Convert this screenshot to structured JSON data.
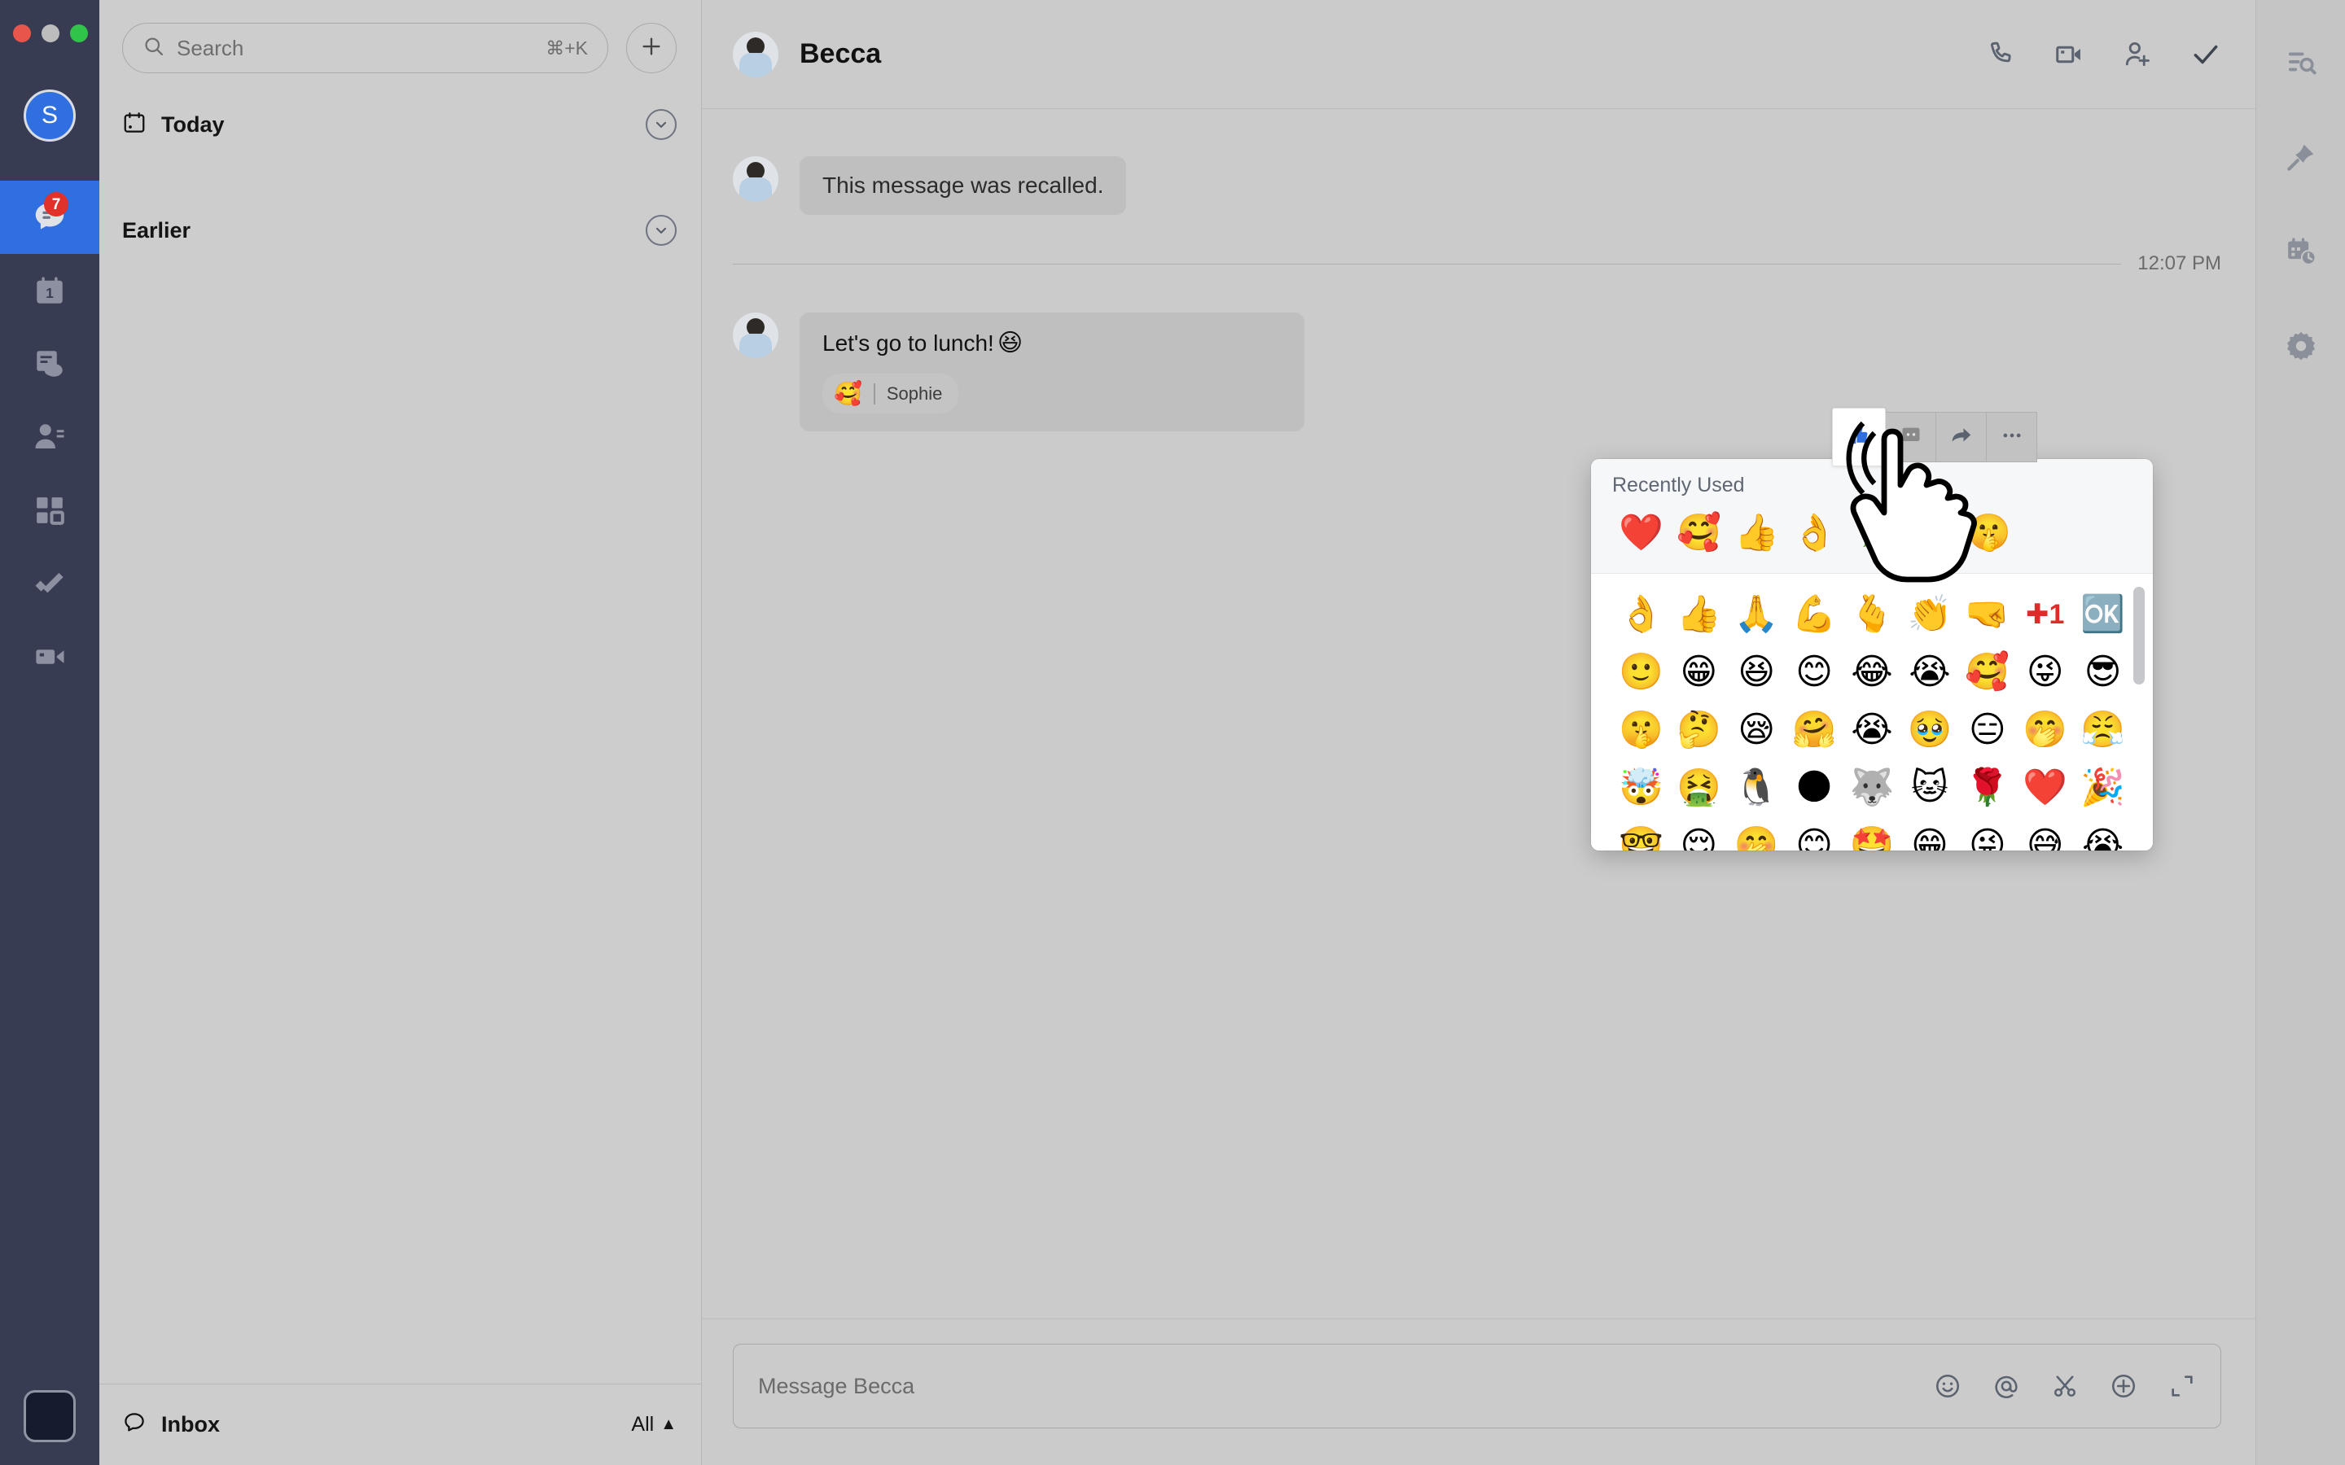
{
  "window": {
    "traffic_lights": [
      "close",
      "minimize",
      "zoom"
    ]
  },
  "rail": {
    "avatar_initial": "S",
    "items": [
      {
        "name": "chat",
        "icon": "chat-icon",
        "active": true,
        "badge": "7"
      },
      {
        "name": "calendar",
        "icon": "calendar-icon",
        "badge": ""
      },
      {
        "name": "docs",
        "icon": "docs-cloud-icon",
        "badge": ""
      },
      {
        "name": "contacts",
        "icon": "contacts-icon",
        "badge": ""
      },
      {
        "name": "workspace",
        "icon": "grid-apps-icon",
        "badge": ""
      },
      {
        "name": "tasks",
        "icon": "check-pen-icon",
        "badge": ""
      },
      {
        "name": "meetings",
        "icon": "video-camera-icon",
        "badge": ""
      }
    ]
  },
  "sidebar": {
    "search": {
      "placeholder": "Search",
      "shortcut": "⌘+K"
    },
    "new_button": "new-chat-button",
    "sections": [
      {
        "label": "Today",
        "icon": "calendar-today-icon",
        "collapse": "chevron-down-icon"
      },
      {
        "label": "Earlier",
        "icon": "",
        "collapse": "chevron-down-icon"
      }
    ],
    "footer": {
      "label": "Inbox",
      "icon": "inbox-icon",
      "filter": "All",
      "filter_caret": "▲"
    }
  },
  "header": {
    "title": "Becca",
    "actions": [
      {
        "name": "call-button",
        "icon": "phone-icon"
      },
      {
        "name": "video-call-button",
        "icon": "video-icon"
      },
      {
        "name": "add-member-button",
        "icon": "add-person-icon"
      },
      {
        "name": "mark-done-button",
        "icon": "check-icon"
      }
    ]
  },
  "thread": {
    "messages": [
      {
        "sender": "Becca",
        "text": "This message was recalled.",
        "recalled": true
      },
      {
        "sender": "Becca",
        "text": "Let's go to lunch!",
        "trailing_emoji": "😆",
        "reaction": {
          "emoji": "🥰",
          "by": "Sophie"
        }
      }
    ],
    "divider_time": "12:07 PM"
  },
  "hover_toolbar": {
    "buttons": [
      {
        "name": "thumbs-up-reaction-button",
        "icon": "thumbs-up-icon",
        "active": true
      },
      {
        "name": "emoji-reaction-button",
        "icon": "emoji-icon",
        "active": false
      },
      {
        "name": "forward-button",
        "icon": "forward-arrow-icon",
        "active": false
      },
      {
        "name": "more-actions-button",
        "icon": "ellipsis-icon",
        "active": false
      }
    ]
  },
  "emoji_picker": {
    "recent_title": "Recently Used",
    "recent": [
      "❤️",
      "🥰",
      "👍",
      "👌",
      "🌹",
      "🤫"
    ],
    "grid_rows": [
      [
        "👌",
        "👍",
        "🙏",
        "💪",
        "🫰",
        "👏",
        "🤜",
        "✚️1",
        "🆗"
      ],
      [
        "🙂",
        "😁",
        "😆",
        "😊",
        "😂",
        "😭",
        "🥰",
        "😜",
        "😎"
      ],
      [
        "🤫",
        "🤔",
        "😪",
        "🤗",
        "😭",
        "🥹",
        "😑",
        "🤭",
        "😤"
      ],
      [
        "🤯",
        "🤮",
        "🐧",
        "🌑",
        "🐺",
        "🐱",
        "🌹",
        "❤️",
        "🎉"
      ],
      [
        "🤓",
        "😌",
        "🤭",
        "😊",
        "🤩",
        "😁",
        "😜",
        "😅",
        "😭"
      ]
    ],
    "scrollbar": "vertical-scrollbar"
  },
  "composer": {
    "placeholder": "Message Becca",
    "actions": [
      {
        "name": "emoji-button",
        "icon": "smiley-icon"
      },
      {
        "name": "mention-button",
        "icon": "at-icon"
      },
      {
        "name": "screenshot-button",
        "icon": "scissors-icon"
      },
      {
        "name": "attach-button",
        "icon": "plus-circle-icon"
      },
      {
        "name": "expand-button",
        "icon": "expand-icon"
      }
    ]
  },
  "right_rail": {
    "items": [
      {
        "name": "search-in-chat",
        "icon": "list-search-icon"
      },
      {
        "name": "pinned",
        "icon": "pin-icon"
      },
      {
        "name": "schedule",
        "icon": "calendar-clock-icon"
      },
      {
        "name": "settings",
        "icon": "gear-icon"
      }
    ]
  },
  "colors": {
    "accent": "#2f6fe0",
    "rail_bg": "#373c52",
    "badge": "#e0312b",
    "panel_bg": "#cdcdcd"
  }
}
